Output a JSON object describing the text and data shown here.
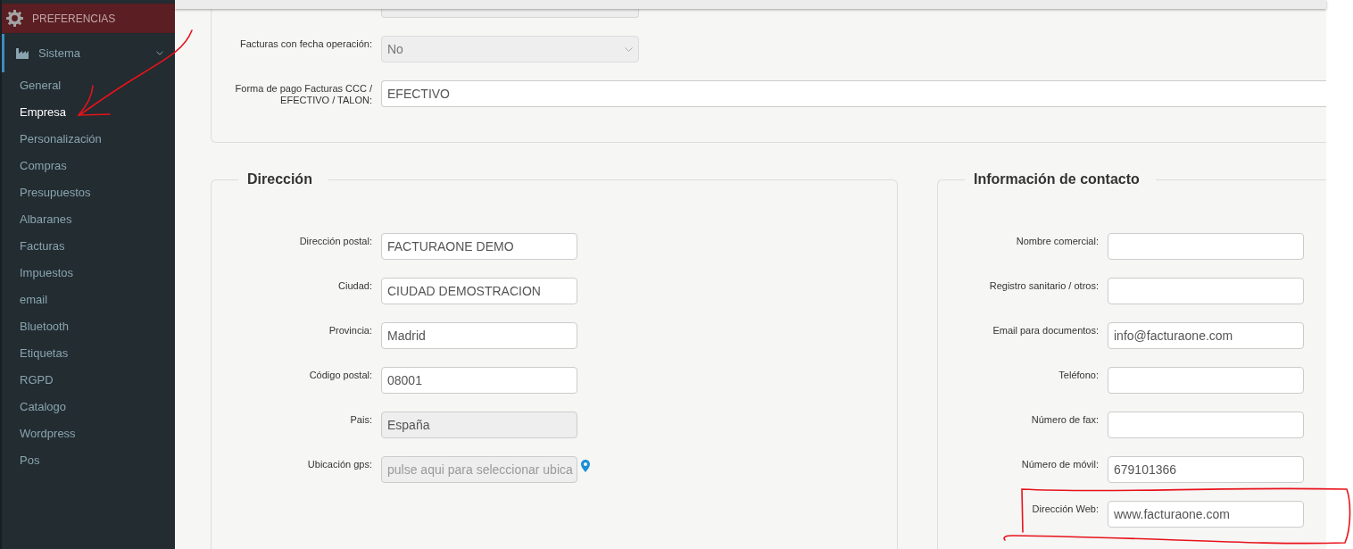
{
  "sidebar": {
    "header": {
      "title": "PREFERENCIAS"
    },
    "group": {
      "label": "Sistema",
      "expanded": true
    },
    "items": [
      {
        "label": "General",
        "selected": false,
        "annotated": false
      },
      {
        "label": "Empresa",
        "selected": true,
        "annotated": true
      },
      {
        "label": "Personalización",
        "selected": false,
        "annotated": false
      },
      {
        "label": "Compras",
        "selected": false,
        "annotated": false
      },
      {
        "label": "Presupuestos",
        "selected": false,
        "annotated": false
      },
      {
        "label": "Albaranes",
        "selected": false,
        "annotated": false
      },
      {
        "label": "Facturas",
        "selected": false,
        "annotated": false
      },
      {
        "label": "Impuestos",
        "selected": false,
        "annotated": false
      },
      {
        "label": "email",
        "selected": false,
        "annotated": false
      },
      {
        "label": "Bluetooth",
        "selected": false,
        "annotated": false
      },
      {
        "label": "Etiquetas",
        "selected": false,
        "annotated": false
      },
      {
        "label": "RGPD",
        "selected": false,
        "annotated": false
      },
      {
        "label": "Catalogo",
        "selected": false,
        "annotated": false
      },
      {
        "label": "Wordpress",
        "selected": false,
        "annotated": false
      },
      {
        "label": "Pos",
        "selected": false,
        "annotated": false
      }
    ]
  },
  "invoice_settings": {
    "fields": [
      {
        "kind": "cut"
      },
      {
        "kind": "select",
        "label": "Facturas con fecha operación:",
        "value": "No",
        "disabled": true
      },
      {
        "kind": "text",
        "label": "Forma de pago Facturas CCC / EFECTIVO / TALON:",
        "value": "EFECTIVO",
        "disabled": false
      }
    ]
  },
  "address": {
    "title": "Dirección",
    "fields": [
      {
        "kind": "text",
        "label": "Dirección postal:",
        "value": "FACTURAONE DEMO",
        "disabled": false
      },
      {
        "kind": "text",
        "label": "Ciudad:",
        "value": "CIUDAD DEMOSTRACION",
        "disabled": false
      },
      {
        "kind": "text",
        "label": "Provincia:",
        "value": "Madrid",
        "disabled": false
      },
      {
        "kind": "text",
        "label": "Código postal:",
        "value": "08001",
        "disabled": false
      },
      {
        "kind": "text",
        "label": "Pais:",
        "value": "España",
        "disabled": true
      },
      {
        "kind": "location",
        "label": "Ubicación gps:",
        "placeholder": "pulse aqui para seleccionar ubica",
        "disabled": true
      }
    ]
  },
  "contact": {
    "title": "Información de contacto",
    "fields": [
      {
        "kind": "text",
        "label": "Nombre comercial:",
        "disabled": false,
        "annotated": false
      },
      {
        "kind": "text",
        "label": "Registro sanitario / otros:",
        "disabled": false,
        "annotated": false
      },
      {
        "kind": "text",
        "label": "Email para documentos:",
        "value": "info@facturaone.com",
        "disabled": false,
        "annotated": false
      },
      {
        "kind": "text",
        "label": "Teléfono:",
        "disabled": false,
        "annotated": false
      },
      {
        "kind": "text",
        "label": "Número de fax:",
        "disabled": false,
        "annotated": false
      },
      {
        "kind": "text",
        "label": "Número de móvil:",
        "value": "679101366",
        "disabled": false,
        "annotated": false
      },
      {
        "kind": "text",
        "label": "Dirección Web:",
        "value": "www.facturaone.com",
        "disabled": false,
        "annotated": true
      }
    ]
  }
}
